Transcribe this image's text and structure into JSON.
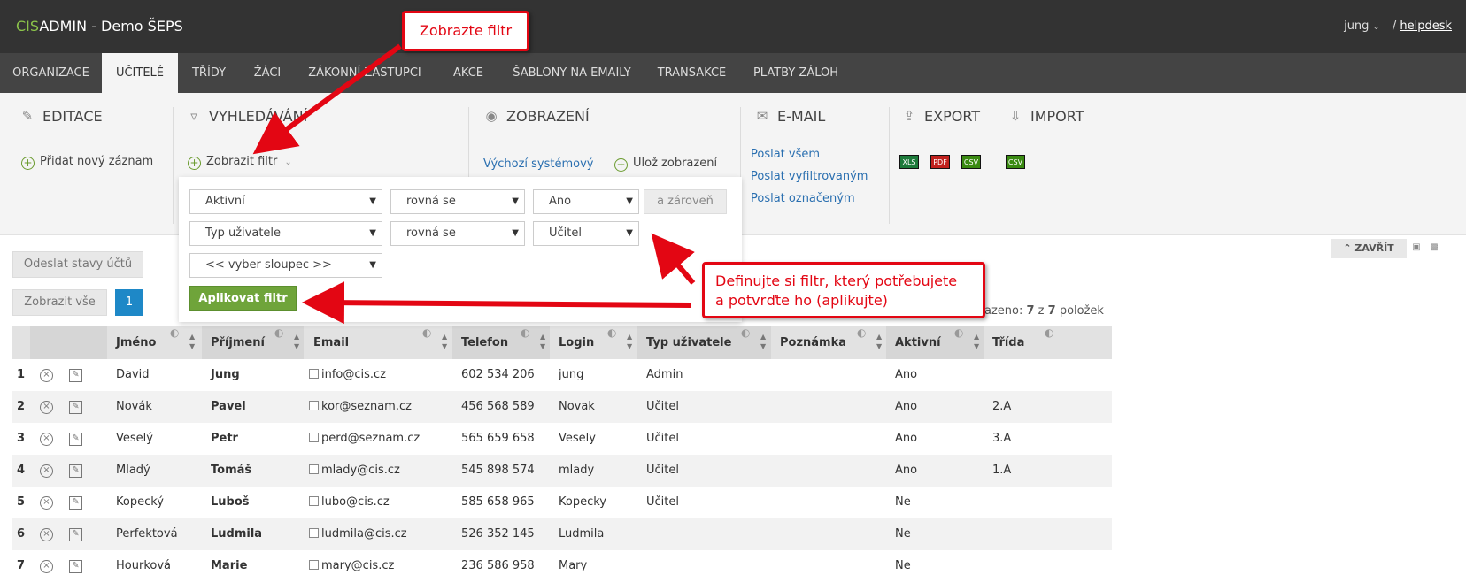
{
  "app": {
    "brand_prefix": "CIS",
    "brand_rest": "ADMIN - Demo ŠEPS",
    "user": "jung",
    "separator": "/",
    "helpdesk": "helpdesk"
  },
  "nav": [
    "ORGANIZACE",
    "UČITELÉ",
    "TŘÍDY",
    "ŽÁCI",
    "ZÁKONNÍ ZÁSTUPCI",
    "AKCE",
    "ŠABLONY NA EMAILY",
    "TRANSAKCE",
    "PLATBY ZÁLOH"
  ],
  "nav_active": "UČITELÉ",
  "toolbar": {
    "editace_title": "EDITACE",
    "add_record": "Přidat nový záznam",
    "search_title": "VYHLEDÁVÁNÍ",
    "show_filter": "Zobrazit filtr",
    "view_title": "ZOBRAZENÍ",
    "default_view": "Výchozí systémový",
    "save_view": "Ulož zobrazení",
    "email_title": "E-MAIL",
    "email_all": "Poslat všem",
    "email_filtered": "Poslat vyfiltrovaným",
    "email_marked": "Poslat označeným",
    "export_title": "EXPORT",
    "import_title": "IMPORT",
    "export_formats": [
      "XLS",
      "PDF",
      "CSV"
    ],
    "import_formats": [
      "CSV"
    ],
    "export_colors": [
      "#1d7a3a",
      "#c0211d",
      "#3a8a12"
    ],
    "import_color": "#3a8a12"
  },
  "filter": {
    "row1": {
      "column": "Aktivní",
      "operator": "rovná se",
      "value": "Ano"
    },
    "row2": {
      "column": "Typ uživatele",
      "operator": "rovná se",
      "value": "Učitel"
    },
    "row3": {
      "column": "<< vyber sloupec >>"
    },
    "and_button": "a zároveň",
    "apply_button": "Aplikovat filtr"
  },
  "actions": {
    "send_states": "Odeslat stavy účtů",
    "show_all": "Zobrazit vše",
    "page": "1",
    "close": "ZAVŘÍT",
    "count_prefix": "azeno: ",
    "count_shown": "7",
    "count_mid": " z ",
    "count_total": "7",
    "count_suffix": " položek"
  },
  "table": {
    "columns": [
      "Jméno",
      "Příjmení",
      "Email",
      "Telefon",
      "Login",
      "Typ uživatele",
      "Poznámka",
      "Aktivní",
      "Třída"
    ],
    "rows": [
      {
        "n": "1",
        "jmeno": "David",
        "prijmeni": "Jung",
        "email": "info@cis.cz",
        "telefon": "602 534 206",
        "login": "jung",
        "typ": "Admin",
        "poznamka": "",
        "aktivni": "Ano",
        "trida": ""
      },
      {
        "n": "2",
        "jmeno": "Novák",
        "prijmeni": "Pavel",
        "email": "kor@seznam.cz",
        "telefon": "456 568 589",
        "login": "Novak",
        "typ": "Učitel",
        "poznamka": "",
        "aktivni": "Ano",
        "trida": "2.A"
      },
      {
        "n": "3",
        "jmeno": "Veselý",
        "prijmeni": "Petr",
        "email": "perd@seznam.cz",
        "telefon": "565 659 658",
        "login": "Vesely",
        "typ": "Učitel",
        "poznamka": "",
        "aktivni": "Ano",
        "trida": "3.A"
      },
      {
        "n": "4",
        "jmeno": "Mladý",
        "prijmeni": "Tomáš",
        "email": "mlady@cis.cz",
        "telefon": "545 898 574",
        "login": "mlady",
        "typ": "Učitel",
        "poznamka": "",
        "aktivni": "Ano",
        "trida": "1.A"
      },
      {
        "n": "5",
        "jmeno": "Kopecký",
        "prijmeni": "Luboš",
        "email": "lubo@cis.cz",
        "telefon": "585 658 965",
        "login": "Kopecky",
        "typ": "Učitel",
        "poznamka": "",
        "aktivni": "Ne",
        "trida": ""
      },
      {
        "n": "6",
        "jmeno": "Perfektová",
        "prijmeni": "Ludmila",
        "email": "ludmila@cis.cz",
        "telefon": "526 352 145",
        "login": "Ludmila",
        "typ": "",
        "poznamka": "",
        "aktivni": "Ne",
        "trida": ""
      },
      {
        "n": "7",
        "jmeno": "Hourková",
        "prijmeni": "Marie",
        "email": "mary@cis.cz",
        "telefon": "236 586 958",
        "login": "Mary",
        "typ": "",
        "poznamka": "",
        "aktivni": "Ne",
        "trida": ""
      }
    ]
  },
  "annotations": {
    "callout1": "Zobrazte filtr",
    "callout2_line1": "Definujte si filtr, který potřebujete",
    "callout2_line2": "a potvrďte ho (aplikujte)"
  },
  "colors": {
    "brand_green": "#8bc34a",
    "topbar": "#333333",
    "nav": "#444444",
    "apply_green": "#6fa43a",
    "page_blue": "#1e88c7",
    "annotation_red": "#e30613"
  },
  "icons": {
    "edit": "pencil-square-icon",
    "search": "funnel-icon",
    "view": "eye-icon",
    "email": "envelope-icon",
    "export": "upload-icon",
    "import": "download-icon",
    "column_hide": "eye-slash-icon",
    "delete_row": "circle-x-icon",
    "edit_row": "edit-icon"
  }
}
